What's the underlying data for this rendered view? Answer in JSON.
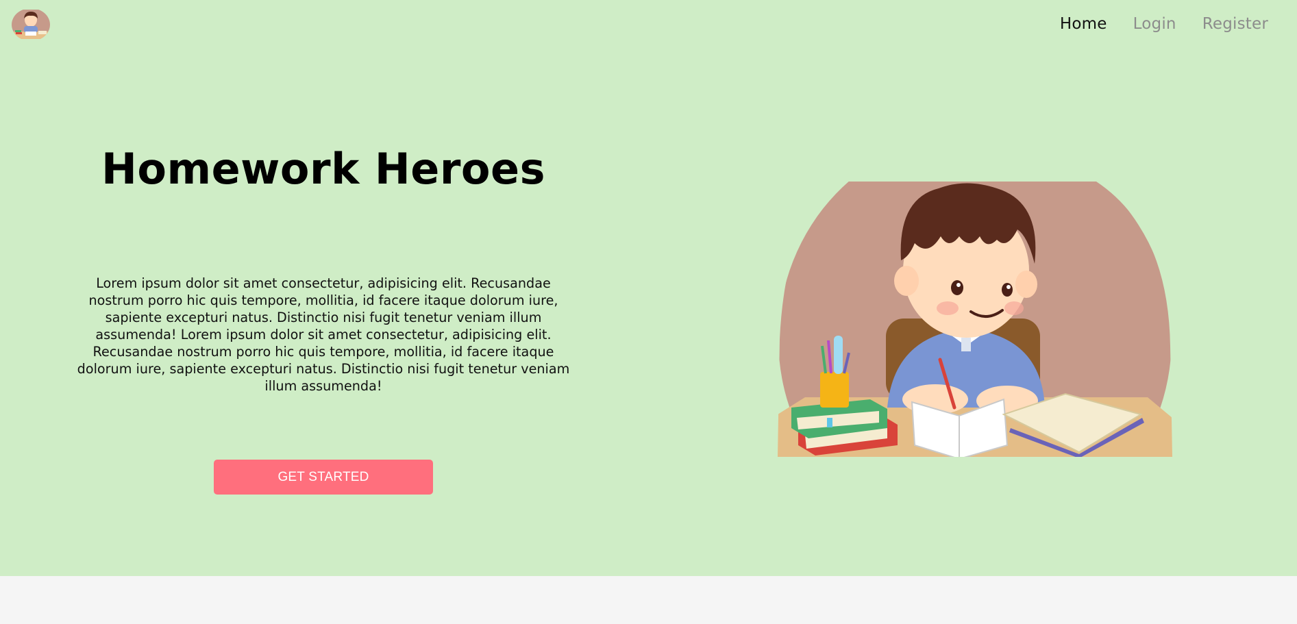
{
  "nav": {
    "items": [
      {
        "label": "Home",
        "active": true
      },
      {
        "label": "Login",
        "active": false
      },
      {
        "label": "Register",
        "active": false
      }
    ]
  },
  "hero": {
    "title": "Homework Heroes",
    "description": "Lorem ipsum dolor sit amet consectetur, adipisicing elit. Recusandae nostrum porro hic quis tempore, mollitia, id facere itaque dolorum iure, sapiente excepturi natus. Distinctio nisi fugit tenetur veniam illum assumenda! Lorem ipsum dolor sit amet consectetur, adipisicing elit. Recusandae nostrum porro hic quis tempore, mollitia, id facere itaque dolorum iure, sapiente excepturi natus. Distinctio nisi fugit tenetur veniam illum assumenda!",
    "cta_label": "GET STARTED"
  },
  "colors": {
    "hero_background": "#cfedc6",
    "page_background": "#f5f5f5",
    "cta_background": "#ff6f7d",
    "nav_active": "#111111",
    "nav_inactive": "#8c8c8c"
  },
  "icons": {
    "logo": "boy-studying-logo",
    "illustration": "boy-doing-homework-illustration"
  }
}
